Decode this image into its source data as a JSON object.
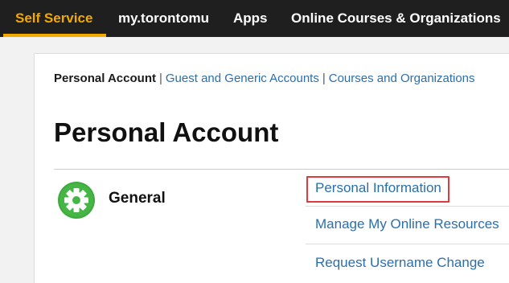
{
  "topnav": {
    "items": [
      {
        "label": "Self Service",
        "active": true
      },
      {
        "label": "my.torontomu",
        "active": false
      },
      {
        "label": "Apps",
        "active": false
      },
      {
        "label": "Online Courses & Organizations",
        "active": false
      }
    ],
    "background_color": "#1f1f1f",
    "accent_color": "#f2a900"
  },
  "breadcrumb": {
    "current": "Personal Account",
    "separator": "|",
    "links": [
      "Guest and Generic Accounts",
      "Courses and Organizations"
    ]
  },
  "page": {
    "title": "Personal Account"
  },
  "section": {
    "label": "General",
    "icon": "gear-icon",
    "icon_color": "#3daa3d",
    "links": [
      {
        "label": "Personal Information",
        "highlighted": true
      },
      {
        "label": "Manage My Online Resources",
        "highlighted": false
      },
      {
        "label": "Request Username Change",
        "highlighted": false
      }
    ]
  },
  "colors": {
    "link": "#2a6fad",
    "highlight_border": "#e0393e"
  }
}
